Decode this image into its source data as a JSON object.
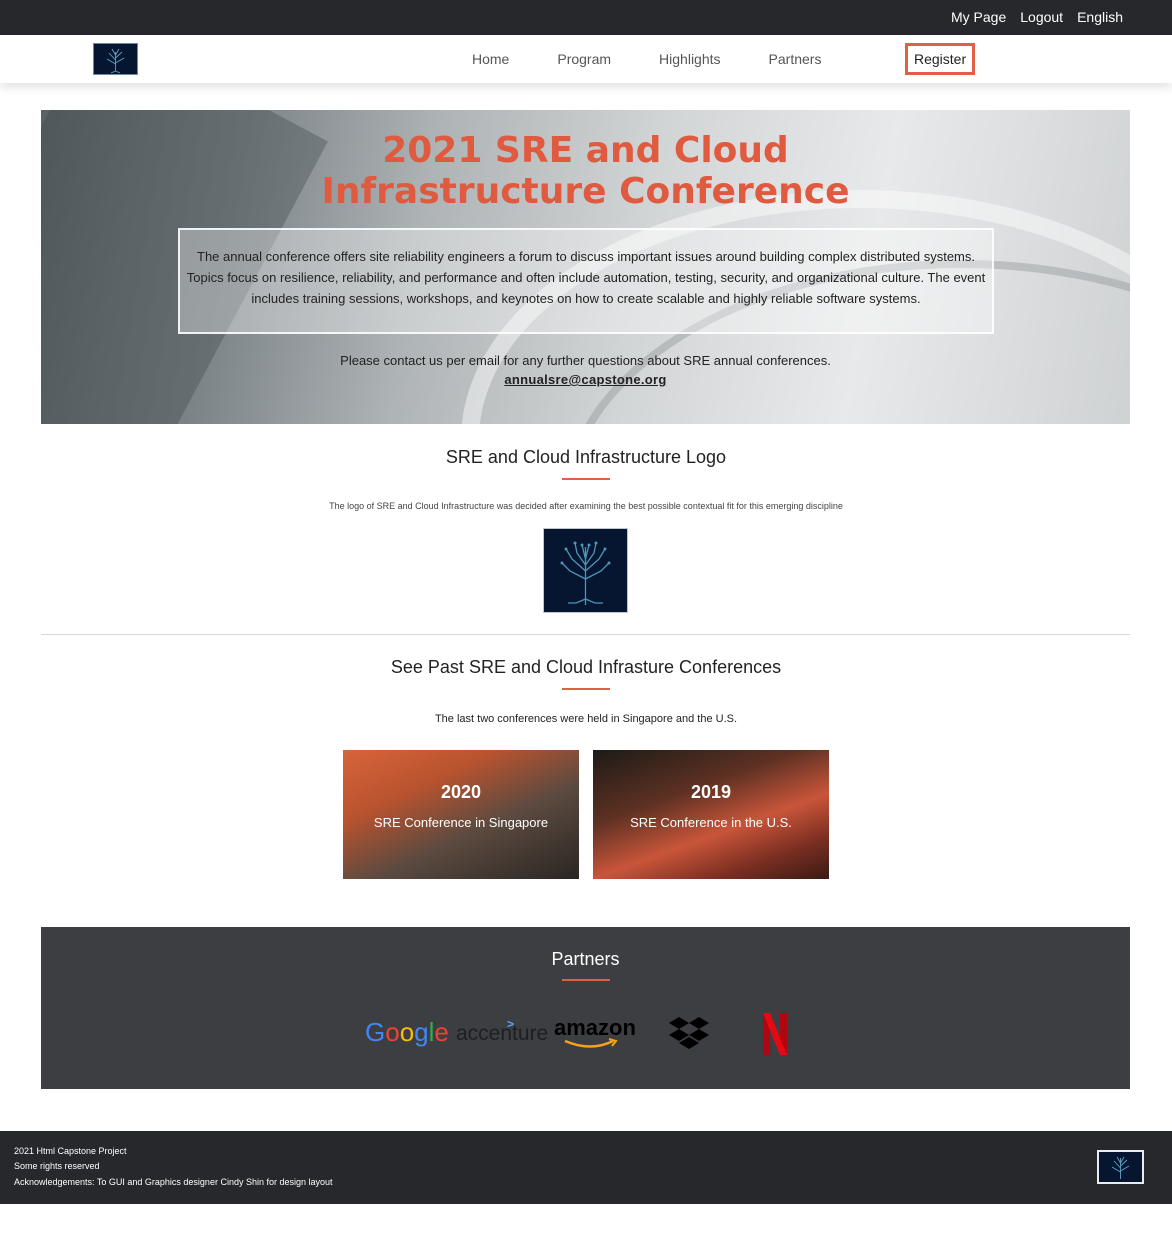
{
  "topbar": {
    "my_page": "My Page",
    "logout": "Logout",
    "language": "English"
  },
  "nav": {
    "logo_icon": "tree-logo-icon",
    "home": "Home",
    "program": "Program",
    "highlights": "Highlights",
    "partners": "Partners",
    "register": "Register"
  },
  "hero": {
    "title_line1": "2021 SRE and Cloud",
    "title_line2": "Infrastructure Conference",
    "description": "The annual conference offers site reliability engineers a forum to discuss important issues around building complex distributed systems. Topics focus on resilience, reliability, and performance and often include automation, testing, security, and organizational culture. The event includes training sessions, workshops, and keynotes on how to create scalable and highly reliable software systems.",
    "contact": "Please contact us per email for any further questions about SRE annual conferences.",
    "email": "annualsre@capstone.org"
  },
  "logo_section": {
    "title": "SRE and Cloud Infrastructure Logo",
    "caption": "The logo of SRE and Cloud Infrastructure was decided after examining the best possible contextual fit for this emerging discipline"
  },
  "past_section": {
    "title": "See Past SRE and Cloud Infrasture Conferences",
    "caption": "The last two conferences were held in Singapore and the U.S.",
    "cards": [
      {
        "year": "2020",
        "subtitle": "SRE Conference in Singapore"
      },
      {
        "year": "2019",
        "subtitle": "SRE Conference in the U.S."
      }
    ]
  },
  "partners": {
    "title": "Partners",
    "logos": [
      "google-logo",
      "accenture-logo",
      "amazon-logo",
      "dropbox-logo",
      "netflix-logo"
    ],
    "google": "Google",
    "accenture": "accenture",
    "amazon": "amazon"
  },
  "footer": {
    "line1": "2021 Html Capstone Project",
    "line2": "Some rights reserved",
    "line3": "Acknowledgements: To GUI and Graphics designer Cindy Shin for design layout"
  },
  "colors": {
    "accent": "#e06046",
    "dark": "#27282c",
    "partners_bg": "#3d3e42",
    "logo_bg": "#061530"
  }
}
